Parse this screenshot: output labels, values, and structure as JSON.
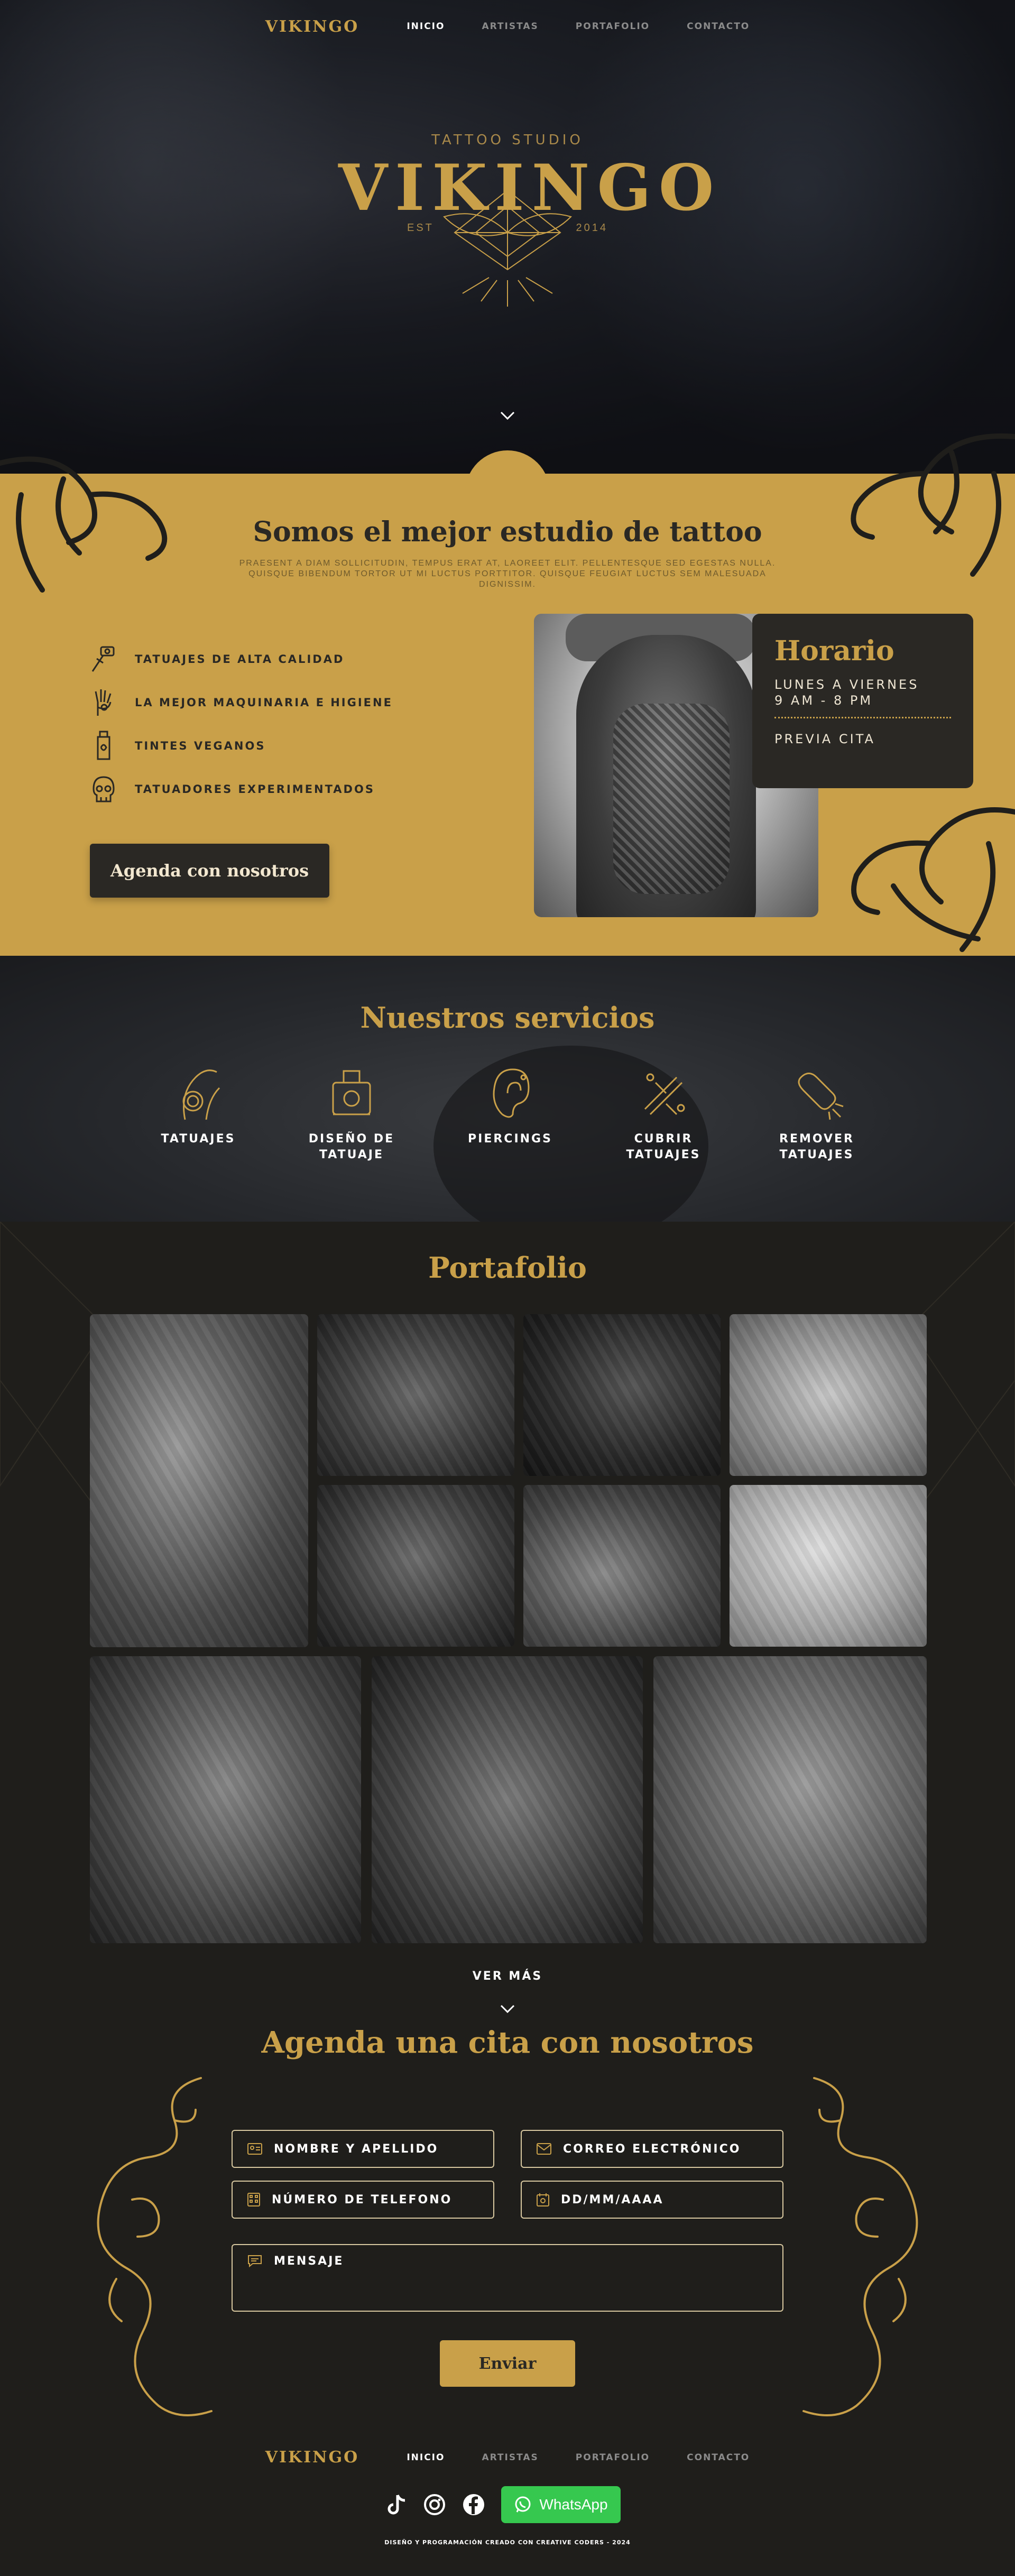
{
  "nav": {
    "logo": "VIKINGO",
    "items": [
      "INICIO",
      "ARTISTAS",
      "PORTAFOLIO",
      "CONTACTO"
    ]
  },
  "hero": {
    "subtitle": "TATTOO STUDIO",
    "brand": "VIKINGO",
    "est_label": "EST",
    "year": "2014"
  },
  "about": {
    "title": "Somos el mejor estudio de tattoo",
    "lede": "Praesent a diam sollicitudin, tempus erat at, laoreet elit. Pellentesque sed egestas nulla. Quisque bibendum tortor ut mi luctus porttitor. Quisque feugiat luctus sem malesuada dignissim.",
    "features": [
      {
        "icon": "tattoo-machine-icon",
        "label": "TATUAJES DE ALTA CALIDAD"
      },
      {
        "icon": "hand-icon",
        "label": "LA MEJOR MAQUINARIA E HIGIENE"
      },
      {
        "icon": "ink-bottle-icon",
        "label": "TINTES VEGANOS"
      },
      {
        "icon": "skull-icon",
        "label": "TATUADORES EXPERIMENTADOS"
      }
    ],
    "cta": "Agenda con nosotros",
    "schedule": {
      "title": "Horario",
      "days": "LUNES A VIERNES",
      "hours": "9 AM - 8 PM",
      "note": "PREVIA CITA"
    }
  },
  "services": {
    "title": "Nuestros servicios",
    "items": [
      {
        "icon": "tattoo-icon",
        "line1": "TATUAJES",
        "line2": ""
      },
      {
        "icon": "design-icon",
        "line1": "DISEÑO DE",
        "line2": "TATUAJE"
      },
      {
        "icon": "ear-piercing-icon",
        "line1": "PIERCINGS",
        "line2": ""
      },
      {
        "icon": "cover-icon",
        "line1": "CUBRIR",
        "line2": "TATUAJES"
      },
      {
        "icon": "laser-icon",
        "line1": "REMOVER",
        "line2": "TATUAJES"
      }
    ]
  },
  "portfolio": {
    "title": "Portafolio",
    "more": "VER MÁS"
  },
  "form": {
    "title": "Agenda una cita con nosotros",
    "name": "NOMBRE Y APELLIDO",
    "email": "CORREO ELECTRÓNICO",
    "phone": "NÚMERO DE TELEFONO",
    "date": "DD/MM/AAAA",
    "message": "MENSAJE",
    "submit": "Enviar"
  },
  "footer": {
    "whatsapp": "WhatsApp",
    "credit": "DISEÑO Y PROGRAMACIÓN CREADO CON CREATIVE CODERS - 2024"
  },
  "colors": {
    "gold": "#c9a049",
    "dark": "#2a2824",
    "whatsapp": "#36c84f"
  }
}
